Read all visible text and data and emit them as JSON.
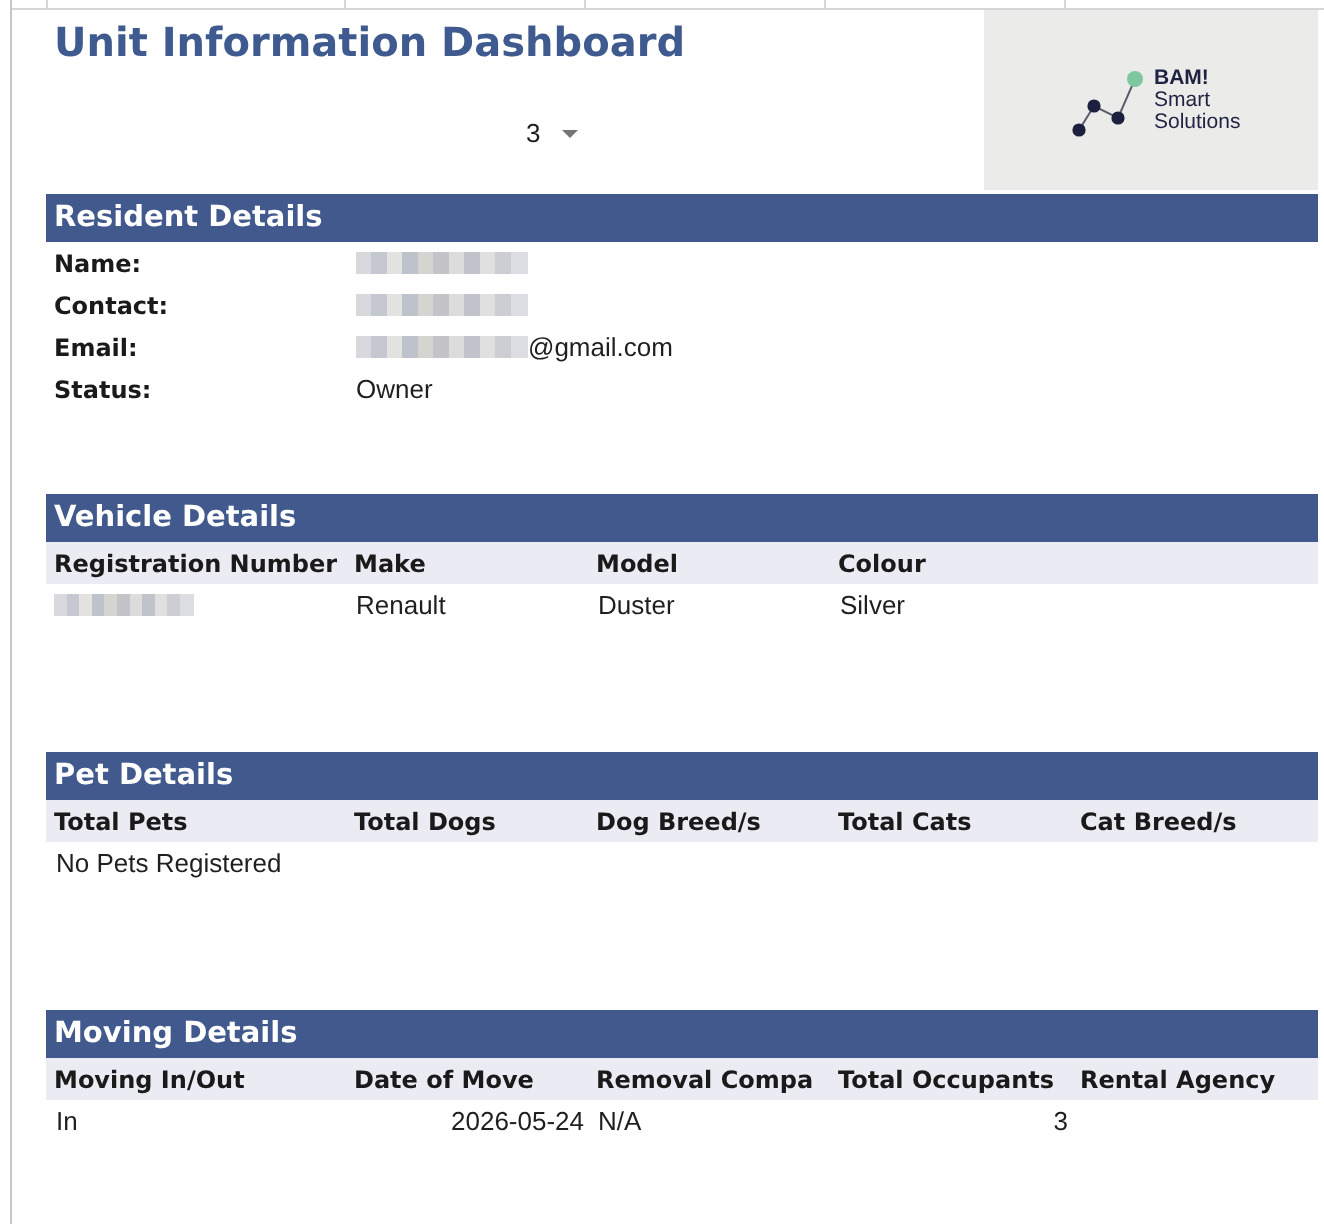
{
  "title": "Unit Information Dashboard",
  "unit_selector": {
    "value": "3"
  },
  "logo": {
    "brand": "BAM!",
    "tagline": "Smart Solutions"
  },
  "sections": [
    {
      "kind": "fields",
      "title": "Resident Details",
      "fields": [
        {
          "label": "Name:",
          "redacted": true
        },
        {
          "label": "Contact:",
          "redacted": true
        },
        {
          "label": "Email:",
          "redacted": true,
          "value": "@gmail.com"
        },
        {
          "label": "Status:",
          "redacted": false,
          "value": "Owner"
        }
      ]
    },
    {
      "kind": "table",
      "title": "Vehicle Details",
      "columns": [
        "Registration Number",
        "Make",
        "Model",
        "Colour"
      ],
      "rows": [
        [
          {
            "kind": "redacted"
          },
          {
            "kind": "text",
            "text": "Renault"
          },
          {
            "kind": "text",
            "text": "Duster"
          },
          {
            "kind": "text",
            "text": "Silver"
          }
        ]
      ]
    },
    {
      "kind": "table",
      "title": "Pet Details",
      "columns": [
        "Total Pets",
        "Total Dogs",
        "Dog Breed/s",
        "Total Cats",
        "Cat Breed/s"
      ],
      "rows": [
        [
          {
            "kind": "text",
            "text": "No Pets Registered"
          }
        ]
      ]
    },
    {
      "kind": "table",
      "title": "Moving Details",
      "columns": [
        "Moving In/Out",
        "Date of Move",
        "Removal Compa",
        "Total Occupants",
        "Rental Agency"
      ],
      "rows": [
        [
          {
            "kind": "text",
            "text": "In"
          },
          {
            "kind": "date",
            "text": "2026-05-24"
          },
          {
            "kind": "text",
            "text": "N/A"
          },
          {
            "kind": "number",
            "text": "3"
          }
        ]
      ]
    }
  ]
}
